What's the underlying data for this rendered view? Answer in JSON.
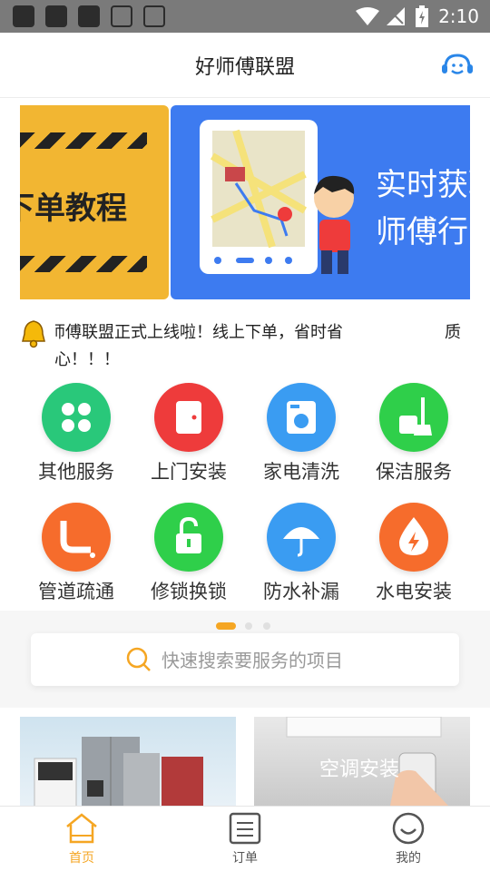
{
  "status_bar": {
    "time": "2:10"
  },
  "header": {
    "title": "好师傅联盟",
    "support_icon": "customer-service-icon"
  },
  "banner": {
    "left_text": "下单教程",
    "right_line1": "实时获取",
    "right_line2": "师傅行"
  },
  "notice": {
    "text": "师傅联盟正式上线啦！线上下单，省时省心！！！",
    "tail": "质"
  },
  "services": [
    {
      "label": "其他服务",
      "icon": "clover-icon",
      "color": "#29c87a"
    },
    {
      "label": "上门安装",
      "icon": "door-icon",
      "color": "#ee3b3b"
    },
    {
      "label": "家电清洗",
      "icon": "washing-machine-icon",
      "color": "#3a9cf2"
    },
    {
      "label": "保洁服务",
      "icon": "broom-icon",
      "color": "#2fcf4a"
    },
    {
      "label": "管道疏通",
      "icon": "pipe-icon",
      "color": "#f66c2c"
    },
    {
      "label": "修锁换锁",
      "icon": "lock-icon",
      "color": "#2fcf4a"
    },
    {
      "label": "防水补漏",
      "icon": "umbrella-icon",
      "color": "#3a9cf2"
    },
    {
      "label": "水电安装",
      "icon": "water-electric-icon",
      "color": "#f66c2c"
    }
  ],
  "search": {
    "placeholder": "快速搜索要服务的项目"
  },
  "cards": {
    "card2_label": "空调安装"
  },
  "tabs": [
    {
      "label": "首页",
      "icon": "home-icon",
      "active": true
    },
    {
      "label": "订单",
      "icon": "orders-icon",
      "active": false
    },
    {
      "label": "我的",
      "icon": "profile-icon",
      "active": false
    }
  ],
  "colors": {
    "accent": "#f5a623",
    "tab_inactive": "#555555"
  }
}
